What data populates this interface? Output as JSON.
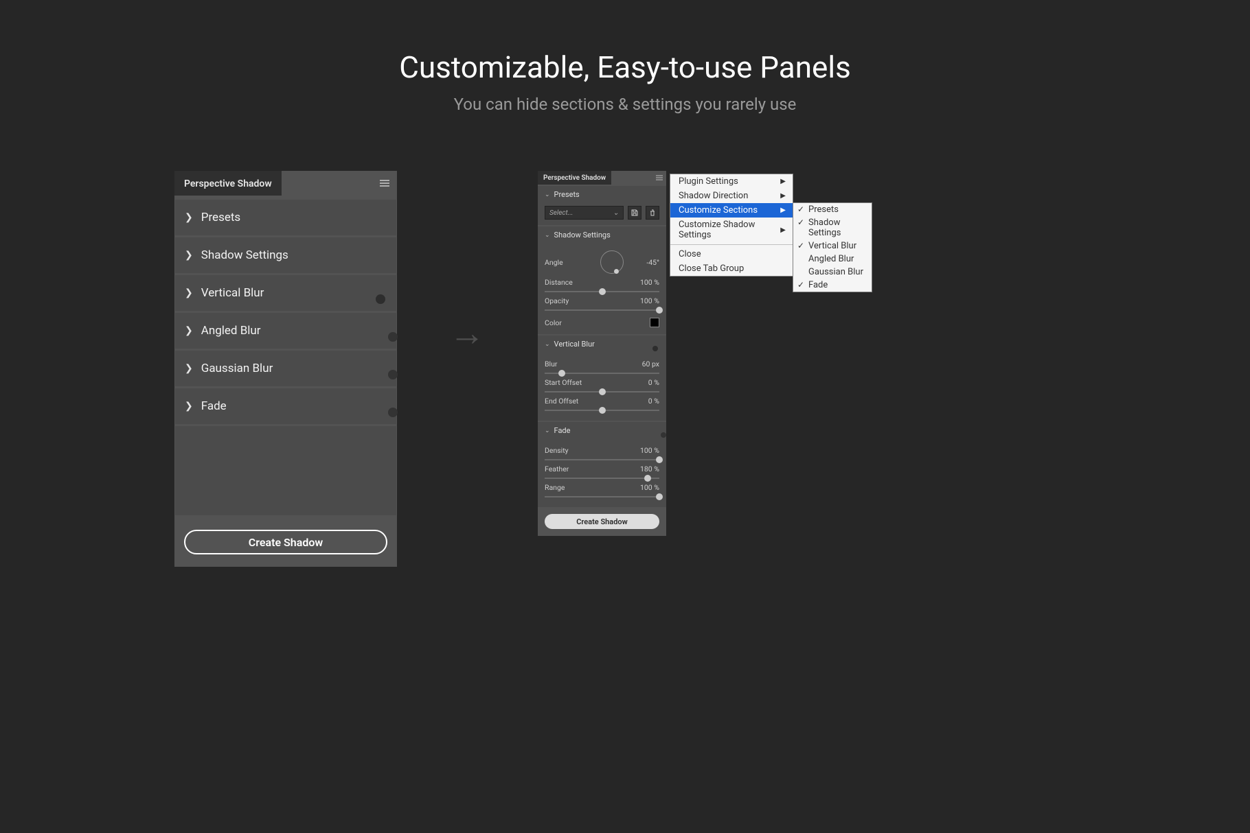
{
  "headline": "Customizable, Easy-to-use Panels",
  "subhead": "You can hide sections & settings you rarely use",
  "panel1": {
    "tab": "Perspective Shadow",
    "sections": [
      {
        "label": "Presets",
        "toggle": null
      },
      {
        "label": "Shadow Settings",
        "toggle": null
      },
      {
        "label": "Vertical Blur",
        "toggle": "on"
      },
      {
        "label": "Angled Blur",
        "toggle": "off"
      },
      {
        "label": "Gaussian Blur",
        "toggle": "off"
      },
      {
        "label": "Fade",
        "toggle": "off"
      }
    ],
    "create": "Create Shadow"
  },
  "panel2": {
    "tab": "Perspective Shadow",
    "presets_label": "Presets",
    "select_placeholder": "Select...",
    "shadow_label": "Shadow Settings",
    "angle_label": "Angle",
    "angle_value": "-45°",
    "distance_label": "Distance",
    "distance_value": "100 %",
    "opacity_label": "Opacity",
    "opacity_value": "100 %",
    "color_label": "Color",
    "vblur_label": "Vertical Blur",
    "blur_label": "Blur",
    "blur_value": "60 px",
    "start_label": "Start Offset",
    "start_value": "0 %",
    "end_label": "End Offset",
    "end_value": "0 %",
    "fade_label": "Fade",
    "density_label": "Density",
    "density_value": "100 %",
    "feather_label": "Feather",
    "feather_value": "180 %",
    "range_label": "Range",
    "range_value": "100 %",
    "create": "Create Shadow"
  },
  "menu": {
    "items": [
      "Plugin Settings",
      "Shadow Direction",
      "Customize Sections",
      "Customize Shadow Settings"
    ],
    "close": "Close",
    "close_tab": "Close Tab Group"
  },
  "submenu": [
    {
      "label": "Presets",
      "checked": true
    },
    {
      "label": "Shadow Settings",
      "checked": true
    },
    {
      "label": "Vertical Blur",
      "checked": true
    },
    {
      "label": "Angled Blur",
      "checked": false
    },
    {
      "label": "Gaussian Blur",
      "checked": false
    },
    {
      "label": "Fade",
      "checked": true
    }
  ]
}
